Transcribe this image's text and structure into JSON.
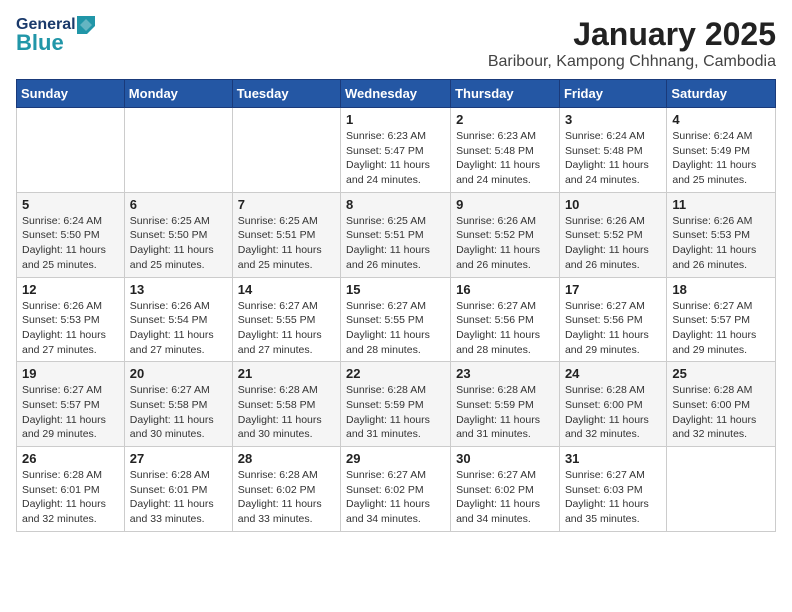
{
  "header": {
    "logo_general": "General",
    "logo_blue": "Blue",
    "main_title": "January 2025",
    "subtitle": "Baribour, Kampong Chhnang, Cambodia"
  },
  "weekdays": [
    "Sunday",
    "Monday",
    "Tuesday",
    "Wednesday",
    "Thursday",
    "Friday",
    "Saturday"
  ],
  "weeks": [
    [
      {
        "day": "",
        "info": ""
      },
      {
        "day": "",
        "info": ""
      },
      {
        "day": "",
        "info": ""
      },
      {
        "day": "1",
        "info": "Sunrise: 6:23 AM\nSunset: 5:47 PM\nDaylight: 11 hours\nand 24 minutes."
      },
      {
        "day": "2",
        "info": "Sunrise: 6:23 AM\nSunset: 5:48 PM\nDaylight: 11 hours\nand 24 minutes."
      },
      {
        "day": "3",
        "info": "Sunrise: 6:24 AM\nSunset: 5:48 PM\nDaylight: 11 hours\nand 24 minutes."
      },
      {
        "day": "4",
        "info": "Sunrise: 6:24 AM\nSunset: 5:49 PM\nDaylight: 11 hours\nand 25 minutes."
      }
    ],
    [
      {
        "day": "5",
        "info": "Sunrise: 6:24 AM\nSunset: 5:50 PM\nDaylight: 11 hours\nand 25 minutes."
      },
      {
        "day": "6",
        "info": "Sunrise: 6:25 AM\nSunset: 5:50 PM\nDaylight: 11 hours\nand 25 minutes."
      },
      {
        "day": "7",
        "info": "Sunrise: 6:25 AM\nSunset: 5:51 PM\nDaylight: 11 hours\nand 25 minutes."
      },
      {
        "day": "8",
        "info": "Sunrise: 6:25 AM\nSunset: 5:51 PM\nDaylight: 11 hours\nand 26 minutes."
      },
      {
        "day": "9",
        "info": "Sunrise: 6:26 AM\nSunset: 5:52 PM\nDaylight: 11 hours\nand 26 minutes."
      },
      {
        "day": "10",
        "info": "Sunrise: 6:26 AM\nSunset: 5:52 PM\nDaylight: 11 hours\nand 26 minutes."
      },
      {
        "day": "11",
        "info": "Sunrise: 6:26 AM\nSunset: 5:53 PM\nDaylight: 11 hours\nand 26 minutes."
      }
    ],
    [
      {
        "day": "12",
        "info": "Sunrise: 6:26 AM\nSunset: 5:53 PM\nDaylight: 11 hours\nand 27 minutes."
      },
      {
        "day": "13",
        "info": "Sunrise: 6:26 AM\nSunset: 5:54 PM\nDaylight: 11 hours\nand 27 minutes."
      },
      {
        "day": "14",
        "info": "Sunrise: 6:27 AM\nSunset: 5:55 PM\nDaylight: 11 hours\nand 27 minutes."
      },
      {
        "day": "15",
        "info": "Sunrise: 6:27 AM\nSunset: 5:55 PM\nDaylight: 11 hours\nand 28 minutes."
      },
      {
        "day": "16",
        "info": "Sunrise: 6:27 AM\nSunset: 5:56 PM\nDaylight: 11 hours\nand 28 minutes."
      },
      {
        "day": "17",
        "info": "Sunrise: 6:27 AM\nSunset: 5:56 PM\nDaylight: 11 hours\nand 29 minutes."
      },
      {
        "day": "18",
        "info": "Sunrise: 6:27 AM\nSunset: 5:57 PM\nDaylight: 11 hours\nand 29 minutes."
      }
    ],
    [
      {
        "day": "19",
        "info": "Sunrise: 6:27 AM\nSunset: 5:57 PM\nDaylight: 11 hours\nand 29 minutes."
      },
      {
        "day": "20",
        "info": "Sunrise: 6:27 AM\nSunset: 5:58 PM\nDaylight: 11 hours\nand 30 minutes."
      },
      {
        "day": "21",
        "info": "Sunrise: 6:28 AM\nSunset: 5:58 PM\nDaylight: 11 hours\nand 30 minutes."
      },
      {
        "day": "22",
        "info": "Sunrise: 6:28 AM\nSunset: 5:59 PM\nDaylight: 11 hours\nand 31 minutes."
      },
      {
        "day": "23",
        "info": "Sunrise: 6:28 AM\nSunset: 5:59 PM\nDaylight: 11 hours\nand 31 minutes."
      },
      {
        "day": "24",
        "info": "Sunrise: 6:28 AM\nSunset: 6:00 PM\nDaylight: 11 hours\nand 32 minutes."
      },
      {
        "day": "25",
        "info": "Sunrise: 6:28 AM\nSunset: 6:00 PM\nDaylight: 11 hours\nand 32 minutes."
      }
    ],
    [
      {
        "day": "26",
        "info": "Sunrise: 6:28 AM\nSunset: 6:01 PM\nDaylight: 11 hours\nand 32 minutes."
      },
      {
        "day": "27",
        "info": "Sunrise: 6:28 AM\nSunset: 6:01 PM\nDaylight: 11 hours\nand 33 minutes."
      },
      {
        "day": "28",
        "info": "Sunrise: 6:28 AM\nSunset: 6:02 PM\nDaylight: 11 hours\nand 33 minutes."
      },
      {
        "day": "29",
        "info": "Sunrise: 6:27 AM\nSunset: 6:02 PM\nDaylight: 11 hours\nand 34 minutes."
      },
      {
        "day": "30",
        "info": "Sunrise: 6:27 AM\nSunset: 6:02 PM\nDaylight: 11 hours\nand 34 minutes."
      },
      {
        "day": "31",
        "info": "Sunrise: 6:27 AM\nSunset: 6:03 PM\nDaylight: 11 hours\nand 35 minutes."
      },
      {
        "day": "",
        "info": ""
      }
    ]
  ]
}
